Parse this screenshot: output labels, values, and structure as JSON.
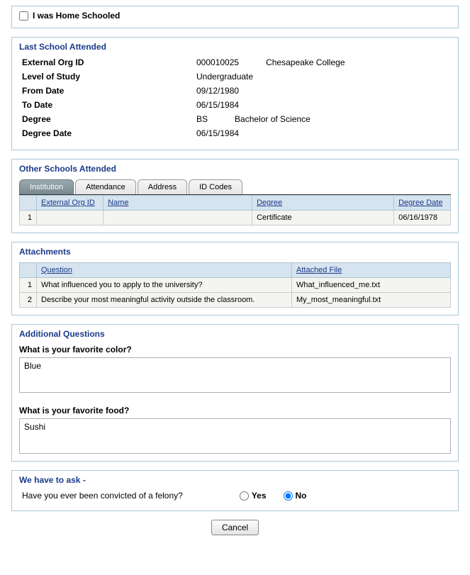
{
  "homeSchooled": {
    "label": "I was Home Schooled",
    "checked": false
  },
  "lastSchool": {
    "title": "Last School Attended",
    "fields": {
      "externalOrgId": {
        "label": "External Org ID",
        "value": "000010025",
        "name": "Chesapeake College"
      },
      "levelOfStudy": {
        "label": "Level of Study",
        "value": "Undergraduate"
      },
      "fromDate": {
        "label": "From Date",
        "value": "09/12/1980"
      },
      "toDate": {
        "label": "To Date",
        "value": "06/15/1984"
      },
      "degree": {
        "label": "Degree",
        "short": "BS",
        "long": "Bachelor of Science"
      },
      "degreeDate": {
        "label": "Degree Date",
        "value": "06/15/1984"
      }
    }
  },
  "otherSchools": {
    "title": "Other Schools Attended",
    "tabs": [
      "Institution",
      "Attendance",
      "Address",
      "ID Codes"
    ],
    "activeTab": 0,
    "columns": [
      "External Org ID",
      "Name",
      "Degree",
      "Degree Date"
    ],
    "rows": [
      {
        "num": "1",
        "externalOrgId": "",
        "name": "",
        "degree": "Certificate",
        "degreeDate": "06/16/1978"
      }
    ]
  },
  "attachments": {
    "title": "Attachments",
    "columns": [
      "Question",
      "Attached File"
    ],
    "rows": [
      {
        "num": "1",
        "question": "What influenced you to apply to the university?",
        "file": "What_influenced_me.txt"
      },
      {
        "num": "2",
        "question": "Describe your most meaningful activity outside the classroom.",
        "file": "My_most_meaningful.txt"
      }
    ]
  },
  "additional": {
    "title": "Additional Questions",
    "q1": {
      "label": "What is your favorite color?",
      "answer": "Blue"
    },
    "q2": {
      "label": "What is your favorite food?",
      "answer": "Sushi"
    }
  },
  "felony": {
    "title": "We have to ask -",
    "question": "Have you ever been convicted of a felony?",
    "yes": "Yes",
    "no": "No",
    "selected": "no"
  },
  "cancel": "Cancel"
}
